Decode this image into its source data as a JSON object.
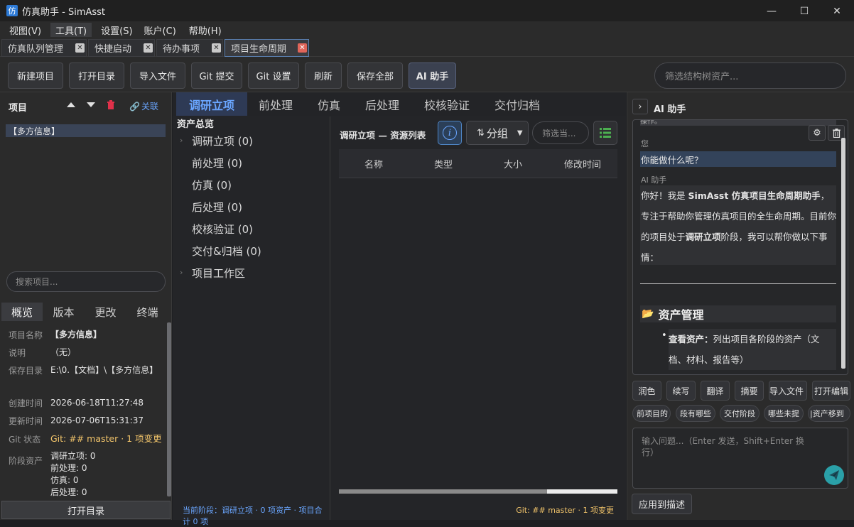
{
  "window": {
    "title": "仿真助手 - SimAsst",
    "app_icon": "仿",
    "minimize": "—",
    "maximize": "☐",
    "close": "✕"
  },
  "menu": [
    "视图(V)",
    "工具(T)",
    "设置(S)",
    "账户(C)",
    "帮助(H)"
  ],
  "tabs": [
    "仿真队列管理",
    "快捷启动",
    "待办事项",
    "项目生命周期"
  ],
  "toolbar": {
    "buttons": [
      "新建项目",
      "打开目录",
      "导入文件",
      "Git 提交",
      "Git 设置",
      "刷新",
      "保存全部",
      "AI 助手"
    ],
    "filter_placeholder": "筛选结构树资产..."
  },
  "project_panel": {
    "title": "项目",
    "link_label": "关联",
    "selected_project": "【多方信息】",
    "search_placeholder": "搜索项目..."
  },
  "info_tabs": [
    "概览",
    "版本",
    "更改",
    "终端"
  ],
  "overview": {
    "name_label": "项目名称",
    "name": "【多方信息】",
    "desc_label": "说明",
    "desc": "（无）",
    "dir_label": "保存目录",
    "dir": "E:\\0.【文档】\\【多方信息】",
    "created_label": "创建时间",
    "created": "2026-06-18T11:27:48",
    "updated_label": "更新时间",
    "updated": "2026-07-06T15:31:37",
    "git_label": "Git 状态",
    "git": "Git: ## master · 1 项变更",
    "assets_label": "阶段资产",
    "assets": [
      "调研立项: 0",
      "前处理: 0",
      "仿真: 0",
      "后处理: 0"
    ]
  },
  "open_dir": "打开目录",
  "stage_tabs": [
    "调研立项",
    "前处理",
    "仿真",
    "后处理",
    "校核验证",
    "交付归档"
  ],
  "tree": {
    "title": "资产总览",
    "items": [
      "调研立项 (0)",
      "前处理 (0)",
      "仿真 (0)",
      "后处理 (0)",
      "校核验证 (0)",
      "交付&归档 (0)",
      "项目工作区"
    ]
  },
  "list": {
    "title": "调研立项 — 资源列表",
    "info_icon": "i",
    "group_label": "分组",
    "filter_placeholder": "筛选当...",
    "columns": [
      "名称",
      "类型",
      "大小",
      "修改时间"
    ]
  },
  "status": {
    "left": "当前阶段：调研立项 · 0 项资产 · 项目合计 0 项",
    "right": "Git: ## master · 1 项变更"
  },
  "ai": {
    "title": "AI 助手",
    "toggle": "›",
    "clipped_top": "操作。",
    "user_label": "您",
    "user_msg": "你能做什么呢？",
    "ai_label": "AI 助手",
    "ai_p1": "你好！我是 ",
    "ai_name": "SimAsst 仿真项目生命周期助手",
    "ai_p2": "，专注于帮助你管理仿真项目的全生命周期。目前你的项目处于",
    "ai_stage": "调研立项",
    "ai_p3": "阶段，我可以帮你做以下事情：",
    "section_icon": "📂",
    "section": "资产管理",
    "bullet_bold": "查看资产：",
    "bullet_text": "列出项目各阶段的资产（文档、材料、报告等）",
    "quick": [
      "润色",
      "续写",
      "翻译",
      "摘要",
      "导入文件",
      "打开编辑"
    ],
    "suggest": [
      "前项目的",
      "段有哪些",
      "交付阶段",
      "哪些未提",
      "|资产移到"
    ],
    "input_placeholder": "输入问题...（Enter 发送，Shift+Enter 换行）",
    "apply": "应用到描述"
  },
  "colors": {
    "accent": "#6aa6ff",
    "stage_active_bg": "#2e3a55",
    "git_text": "#f0c36a",
    "send": "#2aa0a8"
  }
}
